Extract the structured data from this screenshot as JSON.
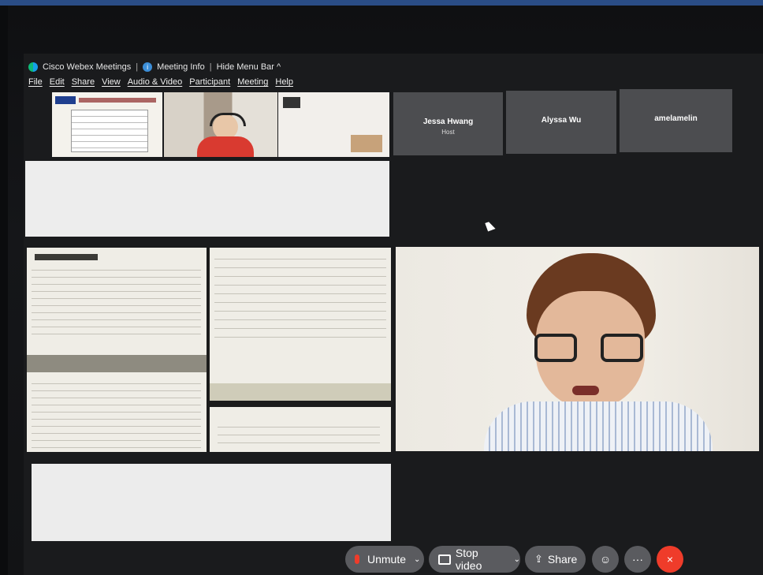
{
  "window": {
    "app_title": "Cisco Webex Meetings",
    "meeting_info_label": "Meeting Info",
    "hide_menu_label": "Hide Menu Bar ^"
  },
  "menu": [
    "File",
    "Edit",
    "Share",
    "View",
    "Audio & Video",
    "Participant",
    "Meeting",
    "Help"
  ],
  "participants": [
    {
      "name": "Jessa Hwang",
      "role": "Host"
    },
    {
      "name": "Alyssa Wu",
      "role": ""
    },
    {
      "name": "amelamelin",
      "role": ""
    }
  ],
  "controls": {
    "unmute_label": "Unmute",
    "stop_video_label": "Stop video",
    "share_label": "Share",
    "more_label": "···",
    "end_label": "×"
  },
  "colors": {
    "end_button": "#ef3c2a",
    "control_bg": "#5a5b5f",
    "tile_bg": "#4c4d50"
  }
}
